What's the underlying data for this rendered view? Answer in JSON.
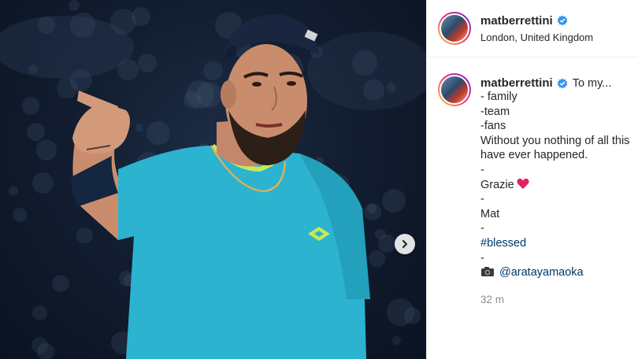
{
  "post": {
    "username": "matberrettini",
    "verified_icon": "verified-badge-icon",
    "location": "London, United Kingdom",
    "caption_intro": "To my...",
    "caption": {
      "l1": "- family",
      "l2": "-team",
      "l3": "-fans",
      "l4": "Without you nothing of all this",
      "l5": "have ever happened.",
      "l6": "-",
      "l7": "Grazie",
      "l8": "-",
      "l9": "Mat",
      "l10": "-",
      "hashtag": "#blessed",
      "l12": "-",
      "mention": "@aratayamaoka"
    },
    "timestamp": "32 m"
  },
  "icons": {
    "heart": "red-heart-icon",
    "camera": "camera-icon",
    "next": "chevron-right-icon"
  },
  "colors": {
    "link": "#00376b",
    "verified": "#3897f0",
    "heart": "#e0245e",
    "shirt": "#2bb3cf",
    "background": "#0e1828"
  }
}
